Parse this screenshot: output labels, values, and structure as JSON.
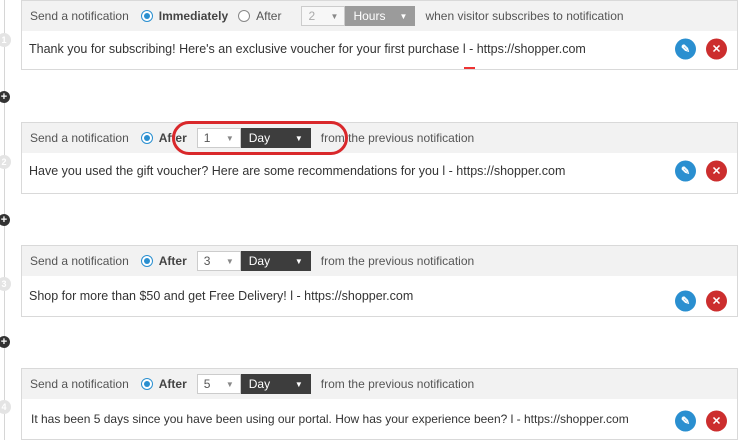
{
  "steps": [
    {
      "number": "1",
      "label": "Send a notification",
      "option_immediately": "Immediately",
      "option_after": "After",
      "selected": "immediately",
      "amount": "2",
      "unit": "Hours",
      "tail": "when visitor subscribes to notification",
      "message": "Thank you for subscribing! Here's an exclusive voucher for your first purchase l - https://shopper.com"
    },
    {
      "number": "2",
      "label": "Send a notification",
      "option_after": "After",
      "selected": "after",
      "amount": "1",
      "unit": "Day",
      "tail": "from the previous notification",
      "message": "Have you used the gift voucher? Here are some recommendations for you l - https://shopper.com"
    },
    {
      "number": "3",
      "label": "Send a notification",
      "option_after": "After",
      "selected": "after",
      "amount": "3",
      "unit": "Day",
      "tail": "from the previous notification",
      "message": "Shop for more than $50 and get Free Delivery! l - https://shopper.com"
    },
    {
      "number": "4",
      "label": "Send a notification",
      "option_after": "After",
      "selected": "after",
      "amount": "5",
      "unit": "Day",
      "tail": "from the previous notification",
      "message": "It has been 5 days since you have been using our portal. How has your experience been? l - https://shopper.com"
    }
  ],
  "icons": {
    "add": "plus-icon",
    "edit": "pencil-icon",
    "delete": "close-icon",
    "caret": "caret-down-icon"
  },
  "colors": {
    "accent": "#2a8fd0",
    "danger": "#cc2e2e",
    "highlight": "#d9282b",
    "unit_bg": "#3d3d3d"
  }
}
